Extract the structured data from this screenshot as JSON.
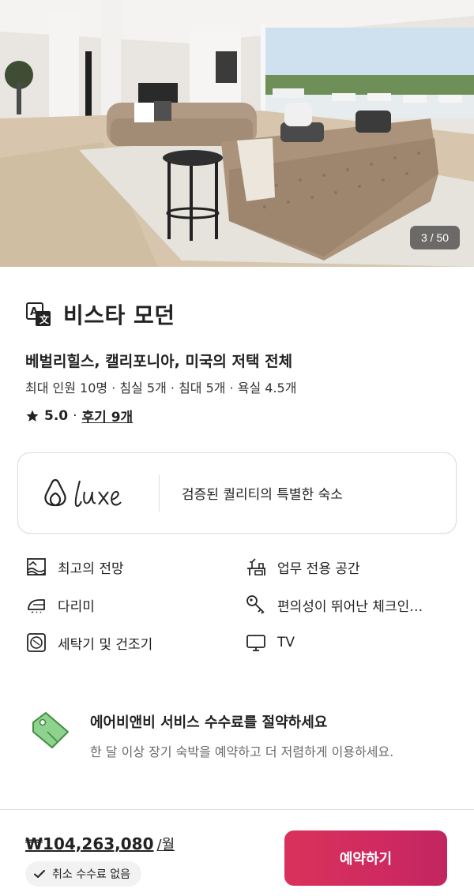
{
  "hero": {
    "photo_counter": "3 / 50"
  },
  "listing": {
    "title": "비스타 모던",
    "location": "베벌리힐스, 캘리포니아, 미국의 저택 전체",
    "capacity": "최대 인원 10명 · 침실 5개 · 침대 5개 · 욕실 4.5개",
    "rating": "5.0",
    "separator": "·",
    "reviews_link": "후기 9개"
  },
  "luxe": {
    "tagline": "검증된 퀄리티의 특별한 숙소"
  },
  "amenities": [
    {
      "label": "최고의 전망",
      "icon": "view-icon"
    },
    {
      "label": "업무 전용 공간",
      "icon": "workspace-icon"
    },
    {
      "label": "다리미",
      "icon": "iron-icon"
    },
    {
      "label": "편의성이 뛰어난 체크인…",
      "icon": "key-icon"
    },
    {
      "label": "세탁기 및 건조기",
      "icon": "washer-icon"
    },
    {
      "label": "TV",
      "icon": "tv-icon"
    }
  ],
  "promo": {
    "title": "에어비앤비 서비스 수수료를 절약하세요",
    "subtitle": "한 달 이상 장기 숙박을 예약하고 더 저렴하게 이용하세요.",
    "icon_color": "#5cb85c"
  },
  "footer": {
    "price": "₩104,263,080",
    "price_unit": "/월",
    "free_cancel": "취소 수수료 없음",
    "reserve_label": "예약하기",
    "accent_color": "#d9325a"
  }
}
